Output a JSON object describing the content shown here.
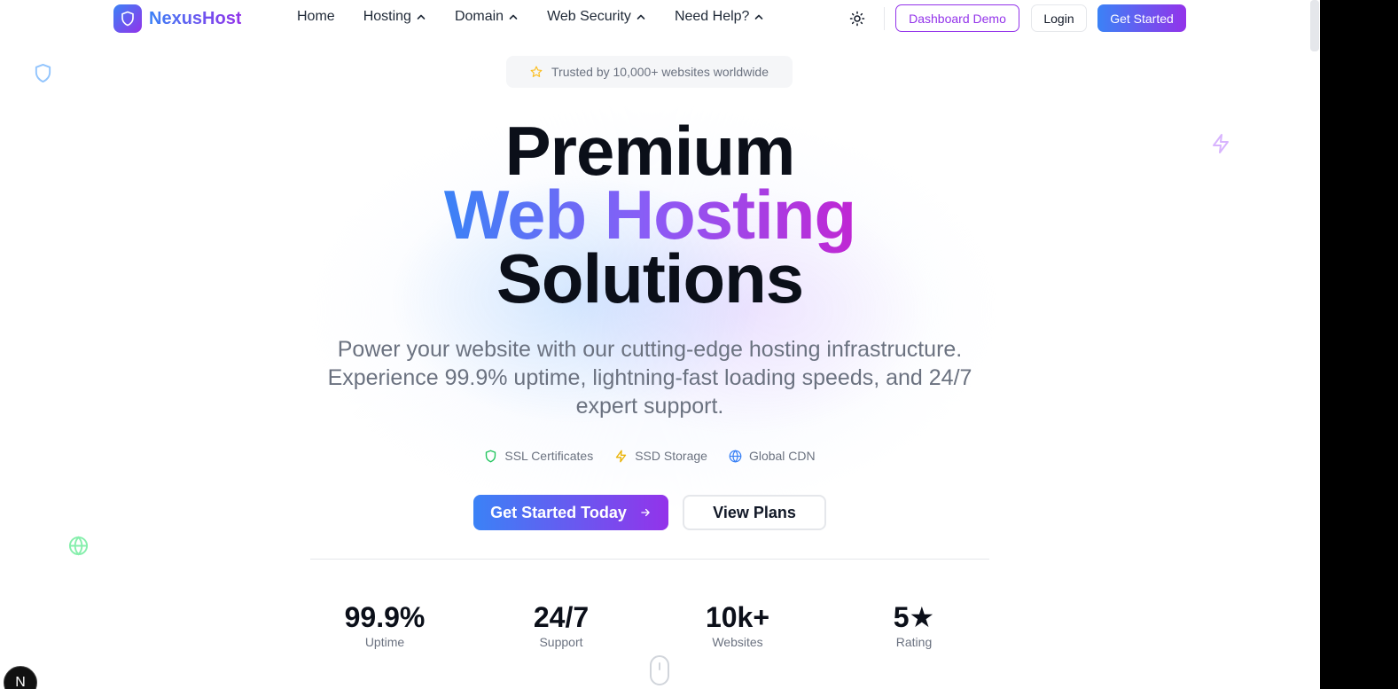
{
  "brand": {
    "name": "NexusHost"
  },
  "nav": {
    "items": [
      {
        "label": "Home",
        "has_dropdown": false
      },
      {
        "label": "Hosting",
        "has_dropdown": true
      },
      {
        "label": "Domain",
        "has_dropdown": true
      },
      {
        "label": "Web Security",
        "has_dropdown": true
      },
      {
        "label": "Need Help?",
        "has_dropdown": true
      }
    ],
    "theme_toggle_icon": "sun-icon",
    "dashboard_demo_label": "Dashboard Demo",
    "login_label": "Login",
    "get_started_label": "Get Started"
  },
  "hero": {
    "trust_badge": "Trusted by 10,000+ websites worldwide",
    "title_line1": "Premium",
    "title_line2": "Web Hosting",
    "title_line3": "Solutions",
    "subtitle": "Power your website with our cutting-edge hosting infrastructure. Experience 99.9% uptime, lightning-fast loading speeds, and 24/7 expert support.",
    "features": [
      {
        "label": "SSL Certificates",
        "icon": "shield-icon",
        "color": "#22c55e"
      },
      {
        "label": "SSD Storage",
        "icon": "lightning-icon",
        "color": "#eab308"
      },
      {
        "label": "Global CDN",
        "icon": "globe-icon",
        "color": "#3b82f6"
      }
    ],
    "cta_primary": "Get Started Today",
    "cta_secondary": "View Plans"
  },
  "stats": [
    {
      "value": "99.9%",
      "label": "Uptime"
    },
    {
      "value": "24/7",
      "label": "Support"
    },
    {
      "value": "10k+",
      "label": "Websites"
    },
    {
      "value": "5★",
      "label": "Rating"
    }
  ],
  "dev_badge": "N",
  "colors": {
    "gradient_start": "#3b82f6",
    "gradient_end": "#9333ea",
    "text_dark": "#0b0f19",
    "text_muted": "#6b7280"
  }
}
